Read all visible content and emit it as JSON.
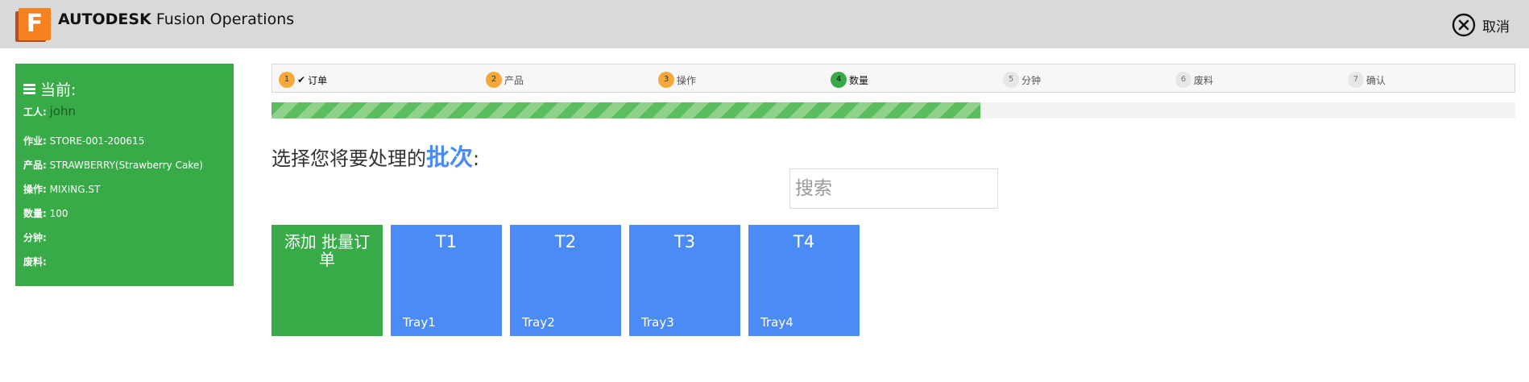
{
  "app": {
    "logo_letter": "F",
    "brand_bold": "AUTODESK",
    "brand_rest": " Fusion Operations",
    "cancel_label": "取消"
  },
  "sidebar": {
    "title": "当前:",
    "worker_label": "工人:",
    "worker_value": "john",
    "rows": [
      {
        "label": "作业:",
        "value": "STORE-001-200615"
      },
      {
        "label": "产品:",
        "value": "STRAWBERRY(Strawberry Cake)"
      },
      {
        "label": "操作:",
        "value": "MIXING.ST"
      },
      {
        "label": "数量:",
        "value": "100"
      },
      {
        "label": "分钟:",
        "value": ""
      },
      {
        "label": "废料:",
        "value": ""
      }
    ]
  },
  "steps": [
    {
      "num": "1",
      "label": "订单",
      "check": "✔",
      "state": "done"
    },
    {
      "num": "2",
      "label": "产品",
      "state": "done"
    },
    {
      "num": "3",
      "label": "操作",
      "state": "done"
    },
    {
      "num": "4",
      "label": "数量",
      "state": "active"
    },
    {
      "num": "5",
      "label": "分钟",
      "state": "todo"
    },
    {
      "num": "6",
      "label": "废料",
      "state": "todo"
    },
    {
      "num": "7",
      "label": "确认",
      "state": "todo"
    }
  ],
  "progress": {
    "percent": 57
  },
  "heading": {
    "prefix": "选择您将要处理的",
    "accent": "批次",
    "suffix": ":"
  },
  "search": {
    "placeholder": "搜索",
    "value": ""
  },
  "add_tile": {
    "label": "添加 批量订单"
  },
  "batches": [
    {
      "code": "T1",
      "name": "Tray1"
    },
    {
      "code": "T2",
      "name": "Tray2"
    },
    {
      "code": "T3",
      "name": "Tray3"
    },
    {
      "code": "T4",
      "name": "Tray4"
    }
  ],
  "colors": {
    "green": "#38ab48",
    "blue": "#4a8bf5",
    "orange": "#f6a839"
  }
}
